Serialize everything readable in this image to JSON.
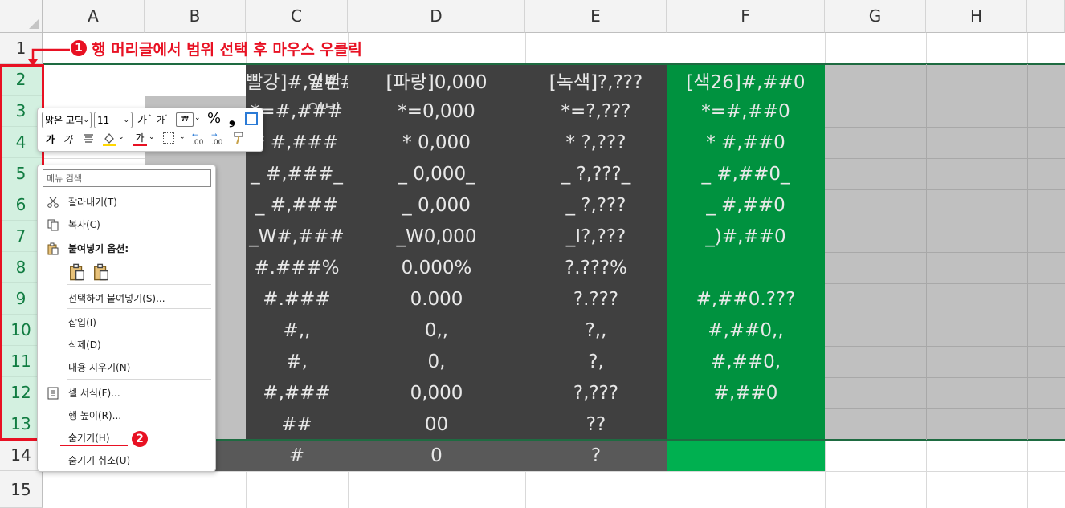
{
  "columns": [
    "A",
    "B",
    "C",
    "D",
    "E",
    "F",
    "G",
    "H"
  ],
  "rows": [
    "1",
    "2",
    "3",
    "4",
    "5",
    "6",
    "7",
    "8",
    "9",
    "10",
    "11",
    "12",
    "13",
    "14",
    "15"
  ],
  "annotation": {
    "step1_number": "1",
    "step1_text": "행 머리글에서 범위 선택 후 마우스 우클릭",
    "step2_number": "2"
  },
  "sheet": {
    "B": [
      "일반",
      "일반",
      "",
      "",
      "",
      "",
      "",
      "",
      "",
      "",
      "",
      "",
      ""
    ],
    "C": [
      "[빨강]#,###",
      "*=#,###",
      "* #,###",
      "_ #,###_",
      "_ #,###",
      "_W#,###",
      "#.###%",
      "#.###",
      "#,,",
      "#,",
      "#,###",
      "##",
      "#"
    ],
    "D": [
      "[파랑]0,000",
      "*=0,000",
      "* 0,000",
      "_ 0,000_",
      "_ 0,000",
      "_W0,000",
      "0.000%",
      "0.000",
      "0,,",
      "0,",
      "0,000",
      "00",
      "0"
    ],
    "E": [
      "[녹색]?,???",
      "*=?,???",
      "* ?,???",
      "_ ?,???_",
      "_ ?,???",
      "_I?,???",
      "?.???%",
      "?.???",
      "?,,",
      "?,",
      "?,???",
      "??",
      "?"
    ],
    "F": [
      "[색26]#,##0",
      "*=#,##0",
      "* #,##0",
      "_ #,##0_",
      "_ #,##0",
      "_)#,##0",
      "",
      "#,##0.???",
      "#,##0,,",
      "#,##0,",
      "#,##0",
      "",
      ""
    ]
  },
  "mini_toolbar": {
    "font_name": "맑은 고딕",
    "font_size": "11",
    "grow_font": "가",
    "shrink_font": "가",
    "percent": "%",
    "comma": "❟",
    "bold": "가",
    "italic": "가",
    "font_color_letter": "가",
    "accent_red": "#e81123",
    "accent_yellow": "#ffd700"
  },
  "context_menu": {
    "search_placeholder": "메뉴 검색",
    "items": [
      {
        "label": "잘라내기(T)",
        "icon": "scissors-icon"
      },
      {
        "label": "복사(C)",
        "icon": "copy-icon"
      },
      {
        "label": "붙여넣기 옵션:",
        "icon": "paste-icon"
      },
      {
        "label": "선택하여 붙여넣기(S)...",
        "icon": ""
      },
      {
        "label": "삽입(I)",
        "icon": ""
      },
      {
        "label": "삭제(D)",
        "icon": ""
      },
      {
        "label": "내용 지우기(N)",
        "icon": ""
      },
      {
        "label": "셀 서식(F)...",
        "icon": "format-cells-icon"
      },
      {
        "label": "행 높이(R)...",
        "icon": ""
      },
      {
        "label": "숨기기(H)",
        "icon": ""
      },
      {
        "label": "숨기기 취소(U)",
        "icon": ""
      }
    ]
  },
  "colors": {
    "dark_fill": "#404040",
    "dark_fill_row14": "#595959",
    "green_fill": "#00923f",
    "green_fill_row14": "#00b050",
    "gray_fill": "#c0c0c0",
    "annotation_red": "#e81123",
    "selected_header": "#d3f0e0"
  }
}
